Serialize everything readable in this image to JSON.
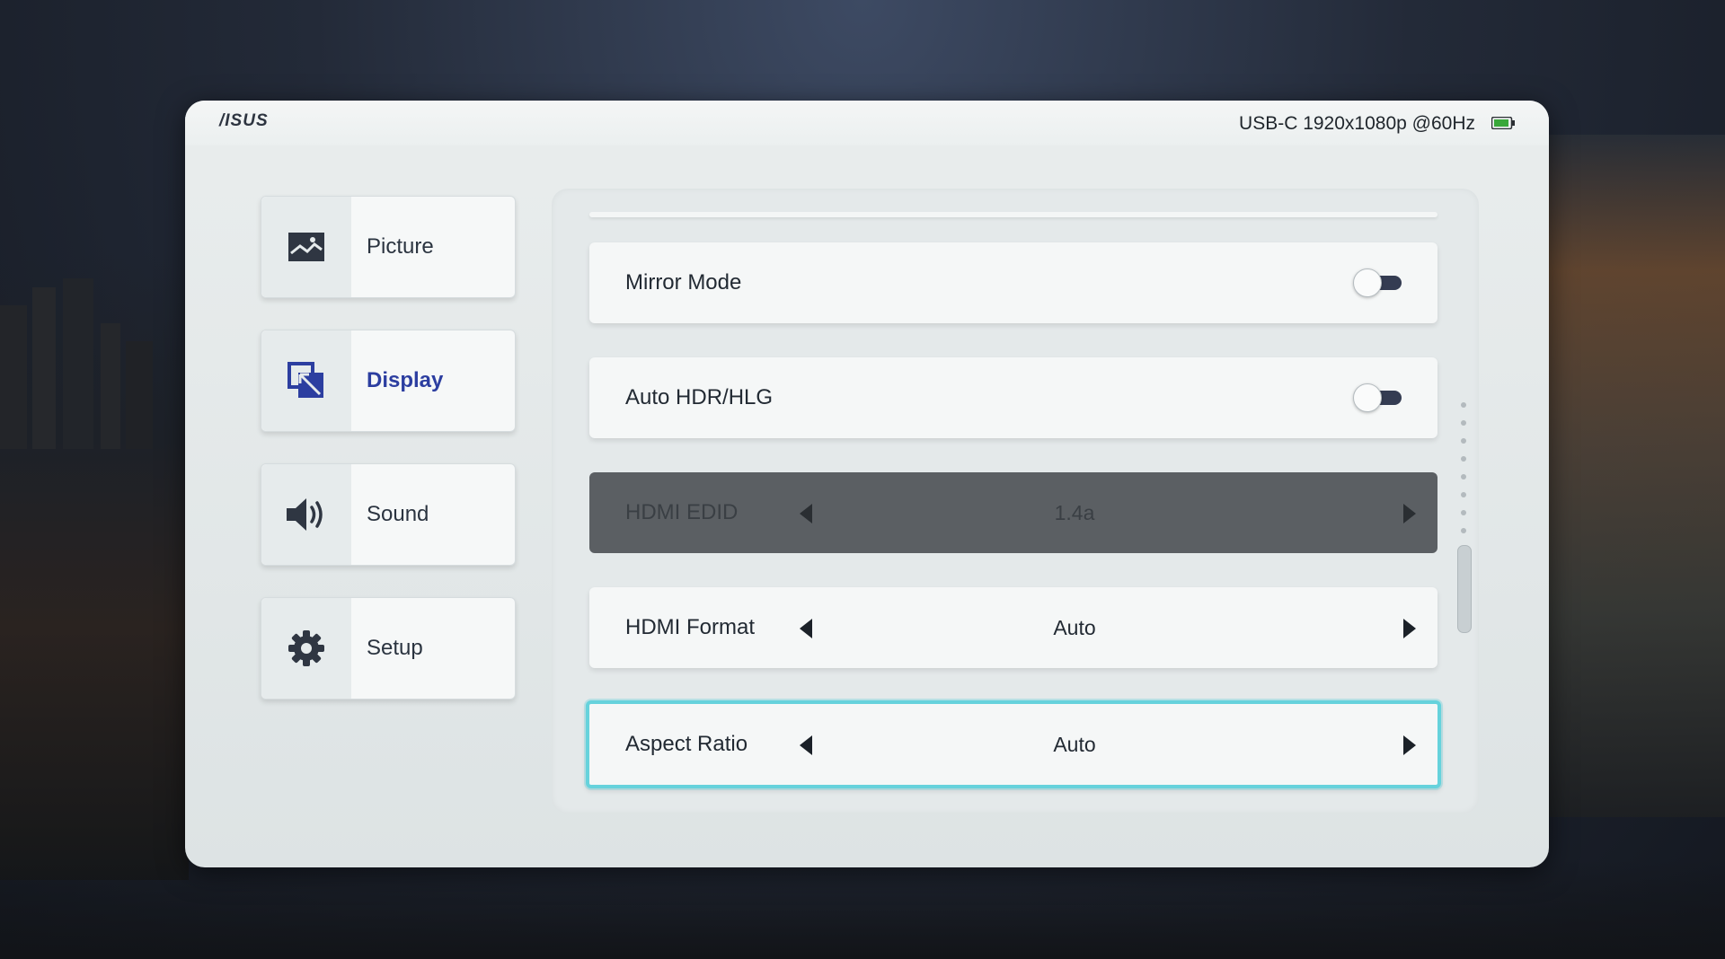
{
  "header": {
    "brand": "/ISUS",
    "source_info": "USB-C  1920x1080p @60Hz",
    "battery_icon": "battery-icon",
    "battery_color": "#39a83a"
  },
  "sidebar": {
    "items": [
      {
        "label": "Picture",
        "icon": "picture-icon",
        "active": false
      },
      {
        "label": "Display",
        "icon": "display-icon",
        "active": true
      },
      {
        "label": "Sound",
        "icon": "speaker-icon",
        "active": false
      },
      {
        "label": "Setup",
        "icon": "gear-icon",
        "active": false
      }
    ]
  },
  "settings": {
    "mirror_mode": {
      "label": "Mirror Mode",
      "state": "off"
    },
    "auto_hdr": {
      "label": "Auto HDR/HLG",
      "state": "off"
    },
    "hdmi_edid": {
      "label": "HDMI EDID",
      "value": "1.4a",
      "enabled": false
    },
    "hdmi_format": {
      "label": "HDMI Format",
      "value": "Auto"
    },
    "aspect_ratio": {
      "label": "Aspect Ratio",
      "value": "Auto",
      "focused": true
    }
  },
  "colors": {
    "accent_focus": "#66d2dc",
    "active_nav": "#2c3ea0",
    "toggle_track": "#343c52",
    "disabled_row": "#5b5f63"
  }
}
